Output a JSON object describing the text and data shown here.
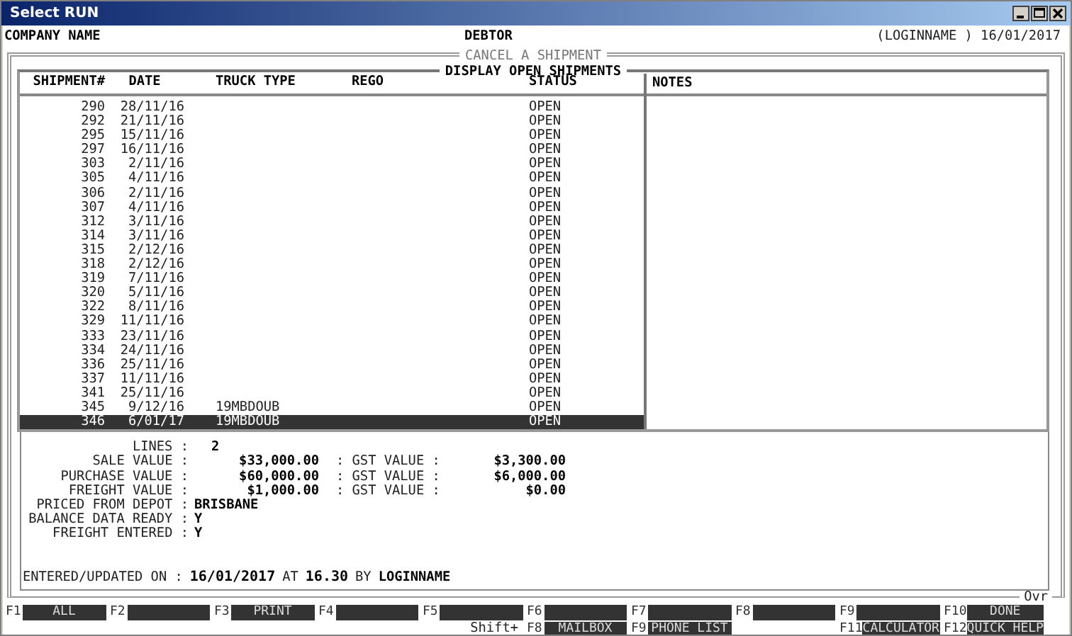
{
  "window": {
    "title": "Select RUN"
  },
  "header": {
    "company": "COMPANY NAME",
    "screen": "DEBTOR",
    "user_date": "(LOGINNAME ) 16/01/2017"
  },
  "frame_title": "CANCEL A SHIPMENT",
  "list_title": "DISPLAY OPEN SHIPMENTS",
  "columns": [
    "SHIPMENT#",
    "DATE",
    "TRUCK TYPE",
    "REGO",
    "STATUS"
  ],
  "notes_heading": "NOTES",
  "rows": [
    {
      "shipment": "290",
      "date": "28/11/16",
      "status": "OPEN",
      "selected": false
    },
    {
      "shipment": "292",
      "date": "21/11/16",
      "status": "OPEN",
      "selected": false
    },
    {
      "shipment": "295",
      "date": "15/11/16",
      "status": "OPEN",
      "selected": false
    },
    {
      "shipment": "297",
      "date": "16/11/16",
      "status": "OPEN",
      "selected": false
    },
    {
      "shipment": "303",
      "date": "2/11/16",
      "status": "OPEN",
      "selected": false
    },
    {
      "shipment": "305",
      "date": "4/11/16",
      "status": "OPEN",
      "selected": false
    },
    {
      "shipment": "306",
      "date": "2/11/16",
      "status": "OPEN",
      "selected": false
    },
    {
      "shipment": "307",
      "date": "4/11/16",
      "status": "OPEN",
      "selected": false
    },
    {
      "shipment": "312",
      "date": "3/11/16",
      "status": "OPEN",
      "selected": false
    },
    {
      "shipment": "314",
      "date": "3/11/16",
      "status": "OPEN",
      "selected": false
    },
    {
      "shipment": "315",
      "date": "2/12/16",
      "status": "OPEN",
      "selected": false
    },
    {
      "shipment": "318",
      "date": "2/12/16",
      "status": "OPEN",
      "selected": false
    },
    {
      "shipment": "319",
      "date": "7/11/16",
      "status": "OPEN",
      "selected": false
    },
    {
      "shipment": "320",
      "date": "5/11/16",
      "status": "OPEN",
      "selected": false
    },
    {
      "shipment": "322",
      "date": "8/11/16",
      "status": "OPEN",
      "selected": false
    },
    {
      "shipment": "329",
      "date": "11/11/16",
      "status": "OPEN",
      "selected": false
    },
    {
      "shipment": "333",
      "date": "23/11/16",
      "status": "OPEN",
      "selected": false
    },
    {
      "shipment": "334",
      "date": "24/11/16",
      "status": "OPEN",
      "selected": false
    },
    {
      "shipment": "336",
      "date": "25/11/16",
      "status": "OPEN",
      "selected": false
    },
    {
      "shipment": "337",
      "date": "11/11/16",
      "status": "OPEN",
      "selected": false
    },
    {
      "shipment": "341",
      "date": "25/11/16",
      "status": "OPEN",
      "selected": false
    },
    {
      "shipment": "345",
      "date": "9/12/16",
      "truck_type": "19MBDOUB",
      "status": "OPEN",
      "selected": false
    },
    {
      "shipment": "346",
      "date": "6/01/17",
      "truck_type": "19MBDOUB",
      "status": "OPEN",
      "selected": true
    }
  ],
  "summary": {
    "lines": {
      "label": "LINES :",
      "value": "2"
    },
    "values": [
      {
        "label": "SALE VALUE :",
        "value": "$33,000.00",
        "gst_label": ": GST VALUE :",
        "gst_value": "$3,300.00"
      },
      {
        "label": "PURCHASE VALUE :",
        "value": "$60,000.00",
        "gst_label": ": GST VALUE :",
        "gst_value": "$6,000.00"
      },
      {
        "label": "FREIGHT VALUE :",
        "value": "$1,000.00",
        "gst_label": ": GST VALUE :",
        "gst_value": "$0.00"
      }
    ],
    "flags": [
      {
        "label": "PRICED FROM DEPOT :",
        "value": "BRISBANE"
      },
      {
        "label": "BALANCE DATA READY :",
        "value": "Y"
      },
      {
        "label": "FREIGHT ENTERED :",
        "value": "Y"
      }
    ],
    "entered": {
      "label": "ENTERED/UPDATED ON :",
      "date": "16/01/2017",
      "at": "AT",
      "time": "16.30",
      "by": "BY",
      "user": "LOGINNAME"
    }
  },
  "mode": "Ovr",
  "function_keys": [
    {
      "key": "F1",
      "label": "ALL"
    },
    {
      "key": "F2"
    },
    {
      "key": "F3",
      "label": "PRINT"
    },
    {
      "key": "F4"
    },
    {
      "key": "F5",
      "note": "Shift+"
    },
    {
      "key": "F6",
      "shift_key": "F8",
      "shift_label": "MAILBOX"
    },
    {
      "key": "F7",
      "shift_key": "F9",
      "shift_label": "PHONE LIST"
    },
    {
      "key": "F8"
    },
    {
      "key": "F9",
      "shift_key": "F11",
      "shift_label": "CALCULATOR"
    },
    {
      "key": "F10",
      "label": "DONE",
      "shift_key": "F12",
      "shift_label": "QUICK HELP"
    }
  ]
}
